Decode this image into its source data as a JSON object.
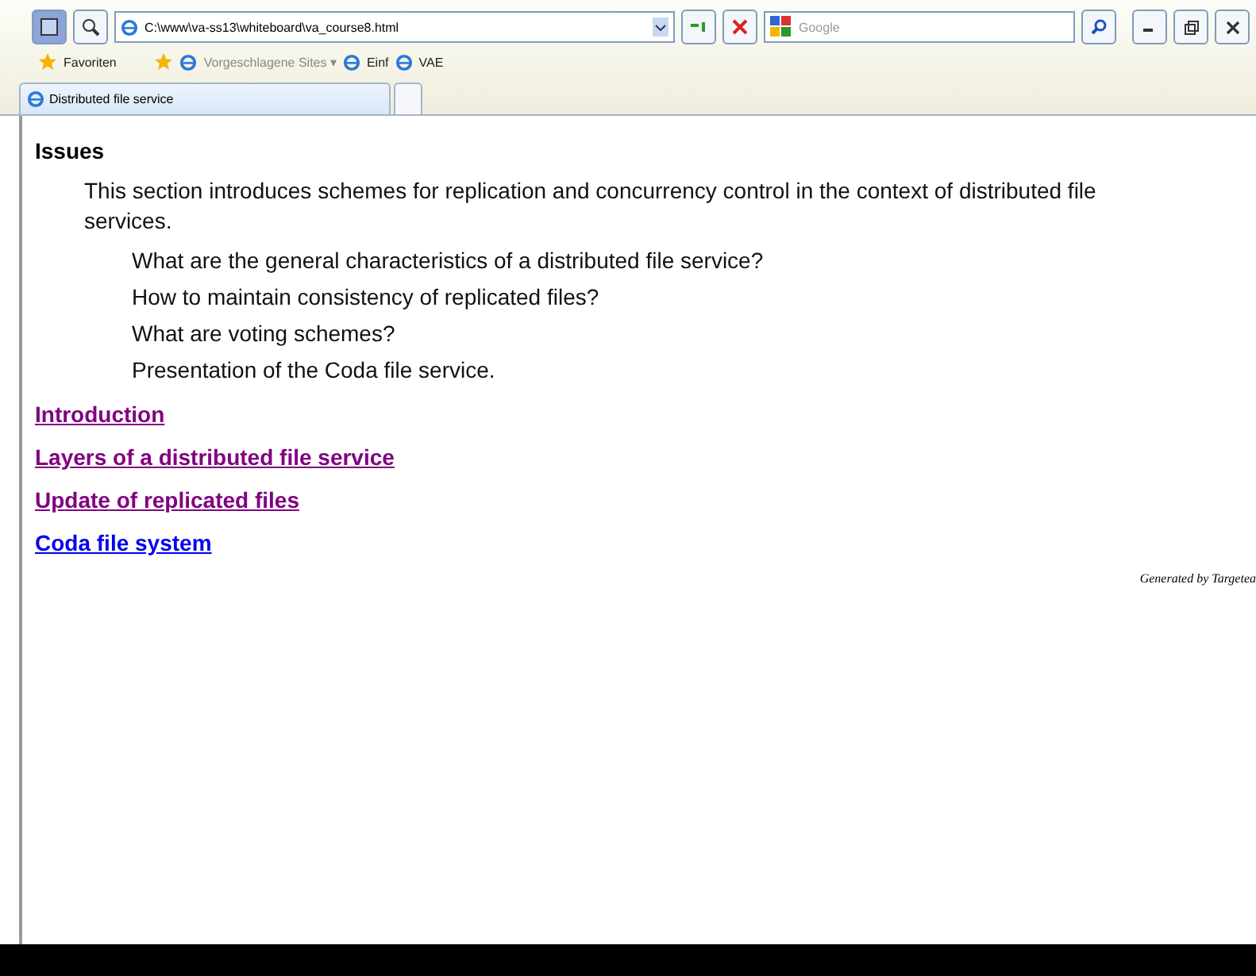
{
  "address_bar": {
    "url": "C:\\www\\va-ss13\\whiteboard\\va_course8.html"
  },
  "search": {
    "placeholder": "Google"
  },
  "favorites_bar": {
    "favorites": "Favoriten",
    "items": [
      {
        "label": "Vorgeschlagene Sites ▾",
        "kind": "suggested"
      },
      {
        "label": "Einf",
        "kind": "page"
      },
      {
        "label": "VAE",
        "kind": "page"
      }
    ]
  },
  "tabs": [
    {
      "label": "Distributed file service",
      "selected": true
    },
    {
      "selected": false
    }
  ],
  "content": {
    "heading": "Issues",
    "intro": "This section introduces schemes for replication and concurrency control in the context of distributed file services.",
    "questions": [
      "What are the general characteristics of a distributed file service?",
      "How to maintain consistency of replicated files?",
      "What are voting schemes?",
      "Presentation of the Coda file service."
    ],
    "links": [
      {
        "label": "Introduction",
        "visited": true
      },
      {
        "label": "Layers of a distributed file service",
        "visited": true
      },
      {
        "label": "Update of replicated files",
        "visited": true
      },
      {
        "label": "Coda file system",
        "visited": false
      }
    ],
    "footer": "Generated by Targetea"
  }
}
